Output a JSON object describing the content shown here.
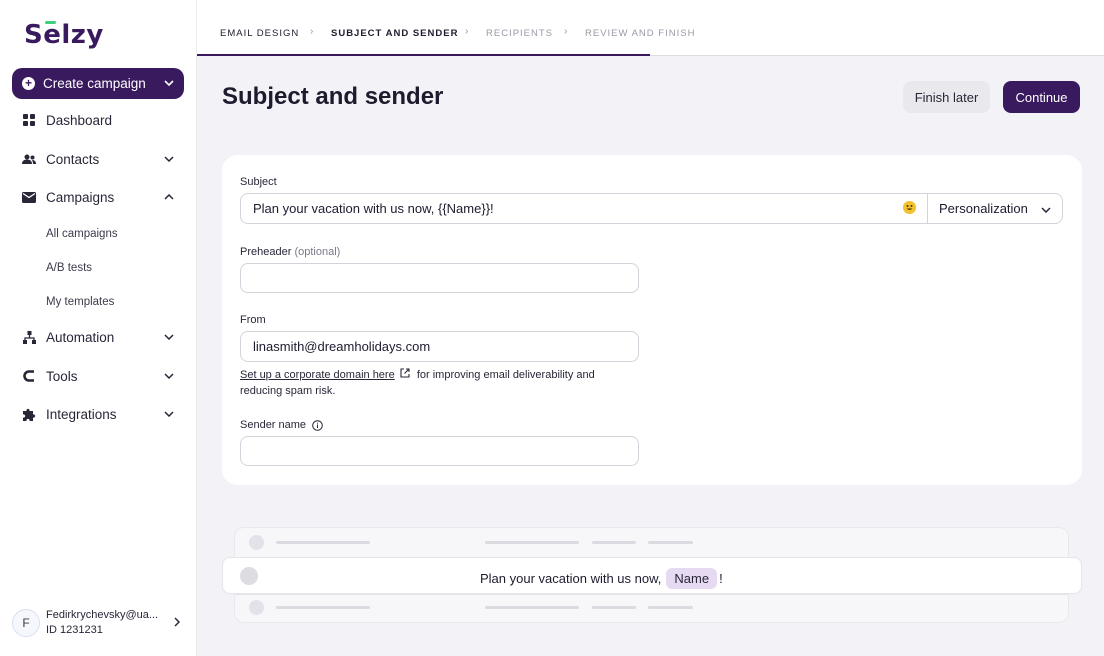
{
  "brand": {
    "logo_text": "Selzy",
    "accent": "#3a1a5e",
    "logo_mark_color": "#3ed17b"
  },
  "sidebar": {
    "create_label": "Create campaign",
    "items": [
      {
        "label": "Dashboard",
        "icon": "grid-icon"
      },
      {
        "label": "Contacts",
        "icon": "users-icon"
      },
      {
        "label": "Campaigns",
        "icon": "envelope-icon"
      },
      {
        "label": "Automation",
        "icon": "flow-icon"
      },
      {
        "label": "Tools",
        "icon": "magnet-icon"
      },
      {
        "label": "Integrations",
        "icon": "puzzle-icon"
      }
    ],
    "campaign_sub": [
      "All campaigns",
      "A/B tests",
      "My templates"
    ],
    "user": {
      "initial": "F",
      "email": "Fedirkrychevsky@ua...",
      "id": "ID 1231231"
    }
  },
  "stepper": {
    "steps": [
      "EMAIL DESIGN",
      "SUBJECT AND SENDER",
      "RECIPIENTS",
      "REVIEW AND FINISH"
    ],
    "active_index": 1
  },
  "page": {
    "title": "Subject and sender",
    "finish_later": "Finish later",
    "continue": "Continue"
  },
  "form": {
    "subject_label": "Subject",
    "subject_value": "Plan your vacation with us now, {{Name}}!",
    "personalization": "Personalization",
    "preheader_label": "Preheader",
    "preheader_optional": "(optional)",
    "preheader_value": "",
    "from_label": "From",
    "from_value": "linasmith@dreamholidays.com",
    "hint_link": "Set up a corporate domain here",
    "hint_text": " for improving email deliverability and reducing spam risk.",
    "sender_name_label": "Sender name",
    "sender_name_value": ""
  },
  "preview": {
    "text_before": "Plan your vacation with us now,",
    "chip": "Name",
    "text_after": "!"
  }
}
